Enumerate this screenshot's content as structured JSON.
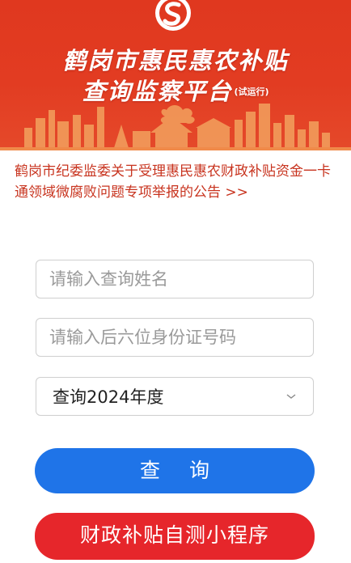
{
  "header": {
    "title_line1": "鹤岗市惠民惠农补贴",
    "title_line2": "查询监察平台",
    "title_suffix": "(试运行)",
    "colors": {
      "banner": "#e23c22",
      "title": "#ffffff"
    },
    "logo_icon": "swirl-s-logo-icon"
  },
  "notice": {
    "text": "鹤岗市纪委监委关于受理惠民惠农财政补贴资金一卡通领域微腐败问题专项举报的公告 >>",
    "color": "#c8341f"
  },
  "form": {
    "name_placeholder": "请输入查询姓名",
    "id_placeholder": "请输入后六位身份证号码",
    "year_select": "查询2024年度",
    "select_icon": "chevron-down-icon"
  },
  "buttons": {
    "query_label": "查 询",
    "mini_program_label": "财政补贴自测小程序",
    "colors": {
      "query": "#1f74e8",
      "mini_program": "#e6262b"
    }
  }
}
